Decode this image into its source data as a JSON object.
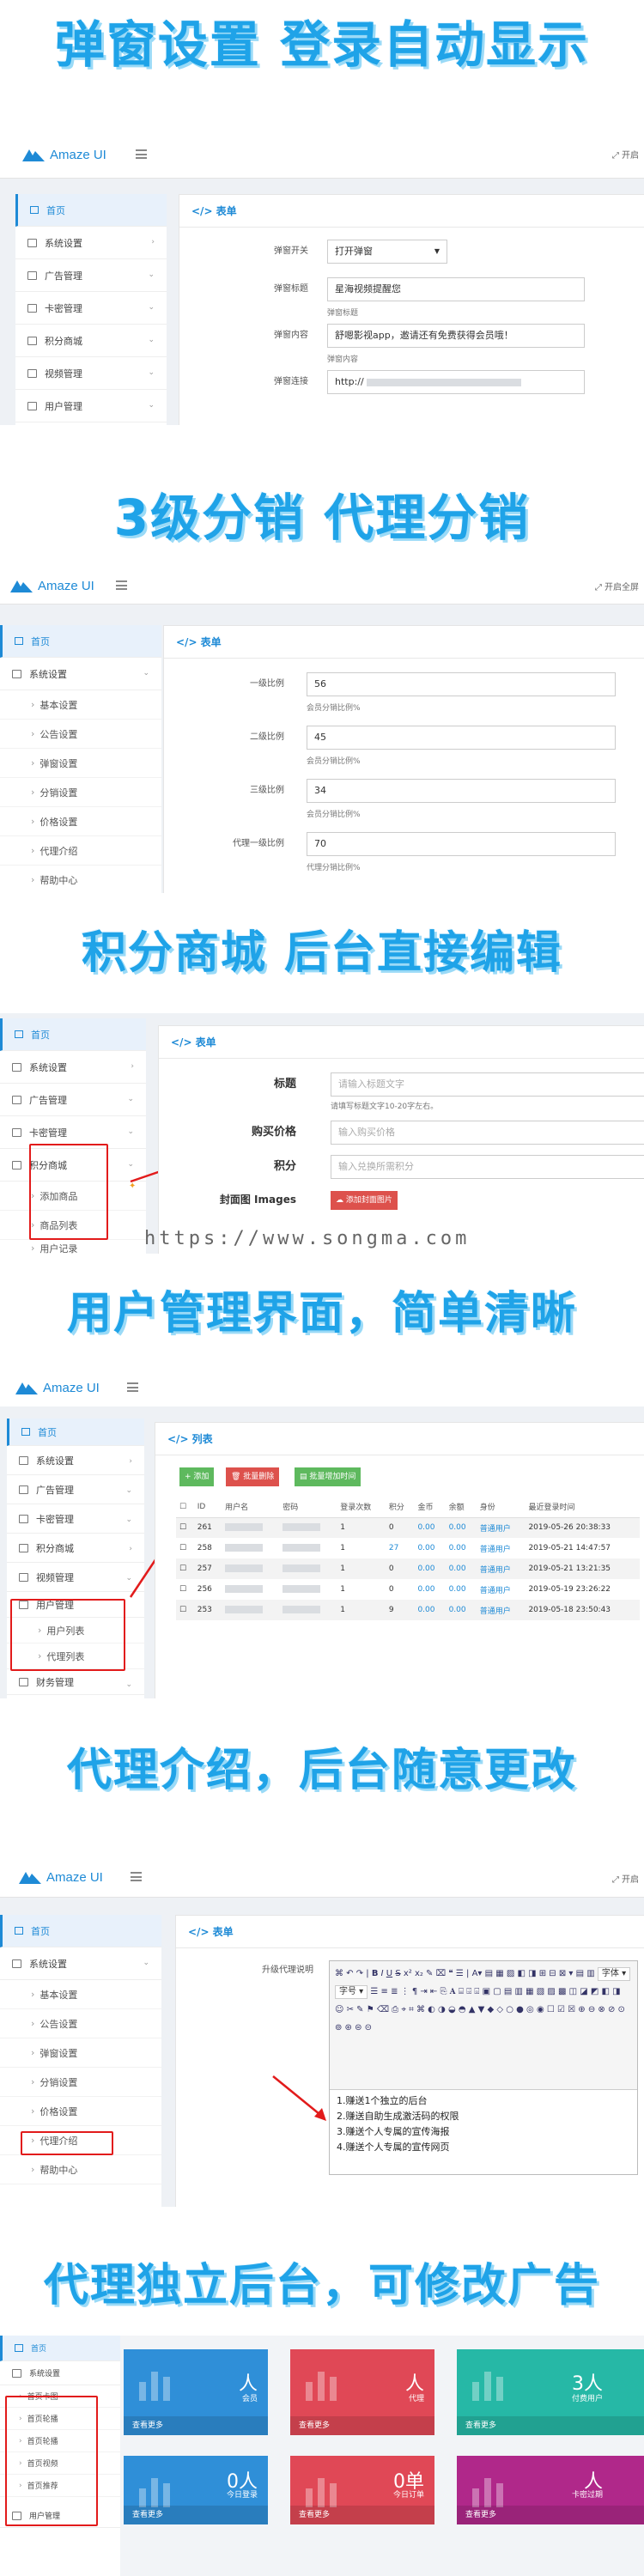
{
  "banners": {
    "b1": "弹窗设置 登录自动显示",
    "b2": "3级分销 代理分销",
    "b3": "积分商城 后台直接编辑",
    "b4": "用户管理界面，简单清晰",
    "b5": "代理介绍，后台随意更改",
    "b6": "代理独立后台，可修改广告"
  },
  "watermark": "https://www.songma.com",
  "app": {
    "logo_text": "Amaze UI",
    "fullscreen_label": "开启全屏",
    "fullscreen_short": "开启"
  },
  "shot1": {
    "sidebar": {
      "home": "首页",
      "items": [
        "系统设置",
        "广告管理",
        "卡密管理",
        "积分商城",
        "视频管理",
        "用户管理"
      ]
    },
    "panel_title": "表单",
    "fields": [
      {
        "label": "弹窗开关",
        "value": "打开弹窗"
      },
      {
        "label": "弹窗标题",
        "value": "星海视频提醒您",
        "help": "弹窗标题"
      },
      {
        "label": "弹窗内容",
        "value": "舒嗯影视app，邀请还有免费获得会员哦！",
        "help": "弹窗内容"
      },
      {
        "label": "弹窗连接",
        "value": "http://"
      }
    ]
  },
  "shot2": {
    "sidebar": {
      "home": "首页",
      "group": "系统设置",
      "subs": [
        "基本设置",
        "公告设置",
        "弹窗设置",
        "分销设置",
        "价格设置",
        "代理介绍",
        "帮助中心"
      ]
    },
    "panel_title": "表单",
    "fields": [
      {
        "label": "一级比例",
        "value": "56",
        "help": "会员分销比例%"
      },
      {
        "label": "二级比例",
        "value": "45",
        "help": "会员分销比例%"
      },
      {
        "label": "三级比例",
        "value": "34",
        "help": "会员分销比例%"
      },
      {
        "label": "代理一级比例",
        "value": "70",
        "help": "代理分销比例%"
      }
    ]
  },
  "shot3": {
    "sidebar": {
      "home": "首页",
      "items": [
        "系统设置",
        "广告管理",
        "卡密管理",
        "积分商城"
      ],
      "subs": [
        "添加商品",
        "商品列表"
      ],
      "cut": "用户记录"
    },
    "panel_title": "表单",
    "fields": [
      {
        "label": "标题",
        "placeholder": "请输入标题文字",
        "help": "请填写标题文字10-20字左右。"
      },
      {
        "label": "购买价格",
        "placeholder": "输入购买价格"
      },
      {
        "label": "积分",
        "placeholder": "输入兑换所需积分"
      }
    ],
    "image_label": "封面图 Images",
    "upload_button": "添加封面图片"
  },
  "shot4": {
    "sidebar": {
      "home": "首页",
      "items": [
        "系统设置",
        "广告管理",
        "卡密管理",
        "积分商城",
        "视频管理",
        "用户管理",
        "财务管理"
      ],
      "subs": [
        "用户列表",
        "代理列表"
      ]
    },
    "panel_title": "列表",
    "buttons": {
      "add": "+ 添加",
      "batch_delete": "批量删除",
      "batch_time": "批量增加时间"
    },
    "columns": [
      "ID",
      "用户名",
      "密码",
      "登录次数",
      "积分",
      "金币",
      "余额",
      "身份",
      "最近登录时间"
    ],
    "rows": [
      {
        "id": "261",
        "logins": "1",
        "points": "0",
        "coins": "0.00",
        "balance": "0.00",
        "role": "普通用户",
        "time": "2019-05-26 20:38:33"
      },
      {
        "id": "258",
        "logins": "1",
        "points": "27",
        "coins": "0.00",
        "balance": "0.00",
        "role": "普通用户",
        "time": "2019-05-21 14:47:57"
      },
      {
        "id": "257",
        "logins": "1",
        "points": "0",
        "coins": "0.00",
        "balance": "0.00",
        "role": "普通用户",
        "time": "2019-05-21 13:21:35"
      },
      {
        "id": "256",
        "logins": "1",
        "points": "0",
        "coins": "0.00",
        "balance": "0.00",
        "role": "普通用户",
        "time": "2019-05-19 23:26:22"
      },
      {
        "id": "253",
        "logins": "1",
        "points": "9",
        "coins": "0.00",
        "balance": "0.00",
        "role": "普通用户",
        "time": "2019-05-18 23:50:43"
      }
    ]
  },
  "shot5": {
    "sidebar": {
      "home": "首页",
      "group": "系统设置",
      "subs": [
        "基本设置",
        "公告设置",
        "弹窗设置",
        "分销设置",
        "价格设置",
        "代理介绍",
        "帮助中心"
      ]
    },
    "panel_title": "表单",
    "editor_label": "升级代理说明",
    "editor_font": "字体",
    "editor_size": "字号",
    "editor_lines": [
      "1.赚送1个独立的后台",
      "2.赚送自助生成激活码的权限",
      "3.赚送个人专属的宣传海报",
      "4.赚送个人专属的宣传网页"
    ]
  },
  "shot6": {
    "sidebar": {
      "home": "首页",
      "group": "系统设置",
      "subs": [
        "首页卡图",
        "首页轮播",
        "首页轮播",
        "首页视频",
        "首页推荐"
      ],
      "bottom": "用户管理"
    },
    "cards": [
      {
        "value": "人",
        "label": "会员",
        "more": "查看更多",
        "color": "#2f8fd8"
      },
      {
        "value": "人",
        "label": "代理",
        "more": "查看更多",
        "color": "#e04856"
      },
      {
        "value": "3人",
        "label": "付费用户",
        "more": "查看更多",
        "color": "#26b8a6"
      },
      {
        "value": "0人",
        "label": "今日登录",
        "more": "查看更多",
        "color": "#2f8fd8"
      },
      {
        "value": "0单",
        "label": "今日订单",
        "more": "查看更多",
        "color": "#e04856"
      },
      {
        "value": "人",
        "label": "卡密过期",
        "more": "查看更多",
        "color": "#b0288a"
      }
    ]
  }
}
